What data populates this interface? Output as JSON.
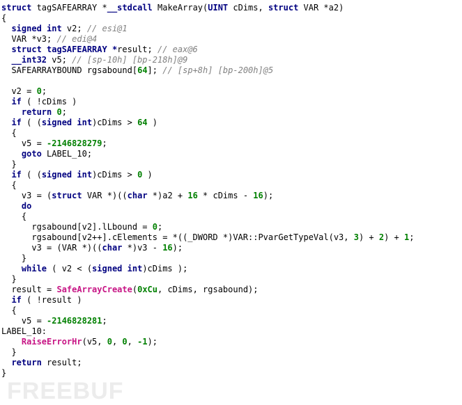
{
  "watermark": "FREEBUF",
  "code": {
    "l0": {
      "sig_pre": "struct",
      "sig_type": " tagSAFEARRAY *",
      "sig_cc": "__stdcall",
      "sig_name": " MakeArray(",
      "p1_t": "UINT",
      "p1_n": " cDims, ",
      "p2_t": "struct",
      "p2_n": " VAR *a2)"
    },
    "l1": "{",
    "l2": {
      "t": "signed int",
      "n": " v2; ",
      "c": "// esi@1"
    },
    "l3": {
      "t": "VAR *",
      "n": "v3; ",
      "c": "// edi@4"
    },
    "l4": {
      "t": "struct tagSAFEARRAY *",
      "n": "result; ",
      "c": "// eax@6"
    },
    "l5": {
      "t": "__int32",
      "n": " v5; ",
      "c": "// [sp-10h] [bp-218h]@9"
    },
    "l6": {
      "t": "SAFEARRAYBOUND",
      "n": " rgsabound[",
      "num": "64",
      "n2": "]; ",
      "c": "// [sp+8h] [bp-200h]@5"
    },
    "l7": "",
    "l8": {
      "a": "  v2 = ",
      "b": "0",
      "c": ";"
    },
    "l9": {
      "a": "  ",
      "k": "if",
      "b": " ( !cDims )"
    },
    "l10": {
      "a": "    ",
      "k": "return",
      "b": " ",
      "n": "0",
      "c": ";"
    },
    "l11": {
      "a": "  ",
      "k": "if",
      "b": " ( (",
      "t": "signed int",
      "c": ")cDims > ",
      "n": "64",
      "d": " )"
    },
    "l12": "  {",
    "l13": {
      "a": "    v5 = ",
      "n": "-2146828279",
      "b": ";"
    },
    "l14": {
      "a": "    ",
      "k": "goto",
      "b": " LABEL_10;"
    },
    "l15": "  }",
    "l16": {
      "a": "  ",
      "k": "if",
      "b": " ( (",
      "t": "signed int",
      "c": ")cDims > ",
      "n": "0",
      "d": " )"
    },
    "l17": "  {",
    "l18": {
      "a": "    v3 = (",
      "t": "struct",
      "b": " VAR *)((",
      "t2": "char",
      "c": " *)a2 + ",
      "n1": "16",
      "d": " * cDims - ",
      "n2": "16",
      "e": ");"
    },
    "l19": {
      "a": "    ",
      "k": "do"
    },
    "l20": "    {",
    "l21": {
      "a": "      rgsabound[v2].lLbound = ",
      "n": "0",
      "b": ";"
    },
    "l22": {
      "a": "      rgsabound[v2++].cElements = *((_DWORD *)VAR::PvarGetTypeVal(v3, ",
      "n1": "3",
      "b": ") + ",
      "n2": "2",
      "c": ") + ",
      "n3": "1",
      "d": ";"
    },
    "l23": {
      "a": "      v3 = (VAR *)((",
      "t": "char",
      "b": " *)v3 - ",
      "n": "16",
      "c": ");"
    },
    "l24": "    }",
    "l25": {
      "a": "    ",
      "k": "while",
      "b": " ( v2 < (",
      "t": "signed int",
      "c": ")cDims );"
    },
    "l26": "  }",
    "l27": {
      "a": "  result = ",
      "f": "SafeArrayCreate",
      "b": "(",
      "n": "0xCu",
      "c": ", cDims, rgsabound);"
    },
    "l28": {
      "a": "  ",
      "k": "if",
      "b": " ( !result )"
    },
    "l29": "  {",
    "l30": {
      "a": "    v5 = ",
      "n": "-2146828281",
      "b": ";"
    },
    "l31": "LABEL_10:",
    "l32": {
      "a": "    ",
      "f": "RaiseErrorHr",
      "b": "(v5, ",
      "n1": "0",
      "c": ", ",
      "n2": "0",
      "d": ", ",
      "n3": "-1",
      "e": ");"
    },
    "l33": "  }",
    "l34": {
      "a": "  ",
      "k": "return",
      "b": " result;"
    },
    "l35": "}"
  }
}
